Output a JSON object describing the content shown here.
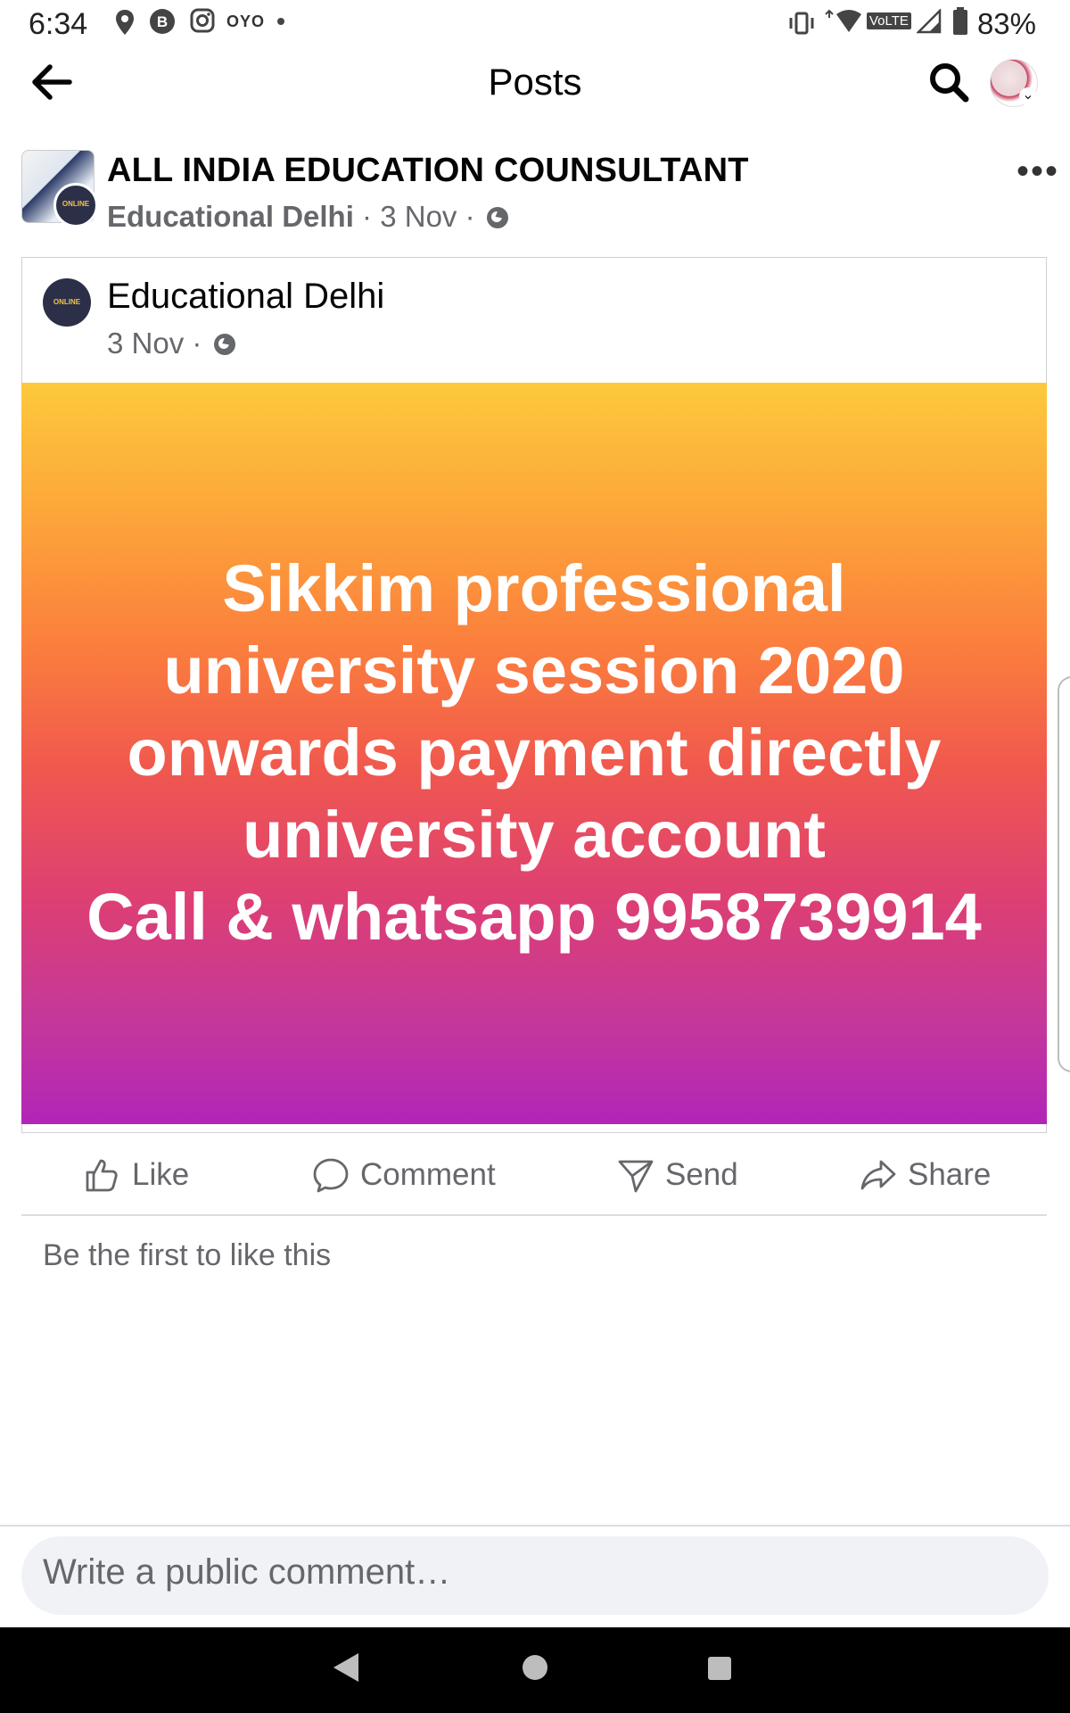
{
  "status_bar": {
    "time": "6:34",
    "notification_icons": [
      "location-pin-icon",
      "b-app-icon",
      "instagram-icon",
      "oyo-icon",
      "dot-icon"
    ],
    "oyo_label": "OYO",
    "volte_label": "VoLTE",
    "battery": "83%"
  },
  "header": {
    "title": "Posts"
  },
  "post": {
    "page_name": "ALL INDIA EDUCATION COUNSULTANT",
    "shared_by": "Educational Delhi",
    "date": "3 Nov",
    "separator": "·",
    "shared": {
      "name": "Educational Delhi",
      "date": "3 Nov",
      "image_text_lines": [
        "Sikkim professional",
        "university session 2020",
        "onwards payment directly",
        "university account",
        "Call & whatsapp 9958739914"
      ],
      "gradient_colors": [
        "#fdc93c",
        "#fb7d3d",
        "#dd3f74",
        "#b125b8"
      ]
    },
    "actions": {
      "like": "Like",
      "comment": "Comment",
      "send": "Send",
      "share": "Share"
    },
    "reactions_text": "Be the first to like this"
  },
  "composer": {
    "placeholder": "Write a public comment…"
  }
}
